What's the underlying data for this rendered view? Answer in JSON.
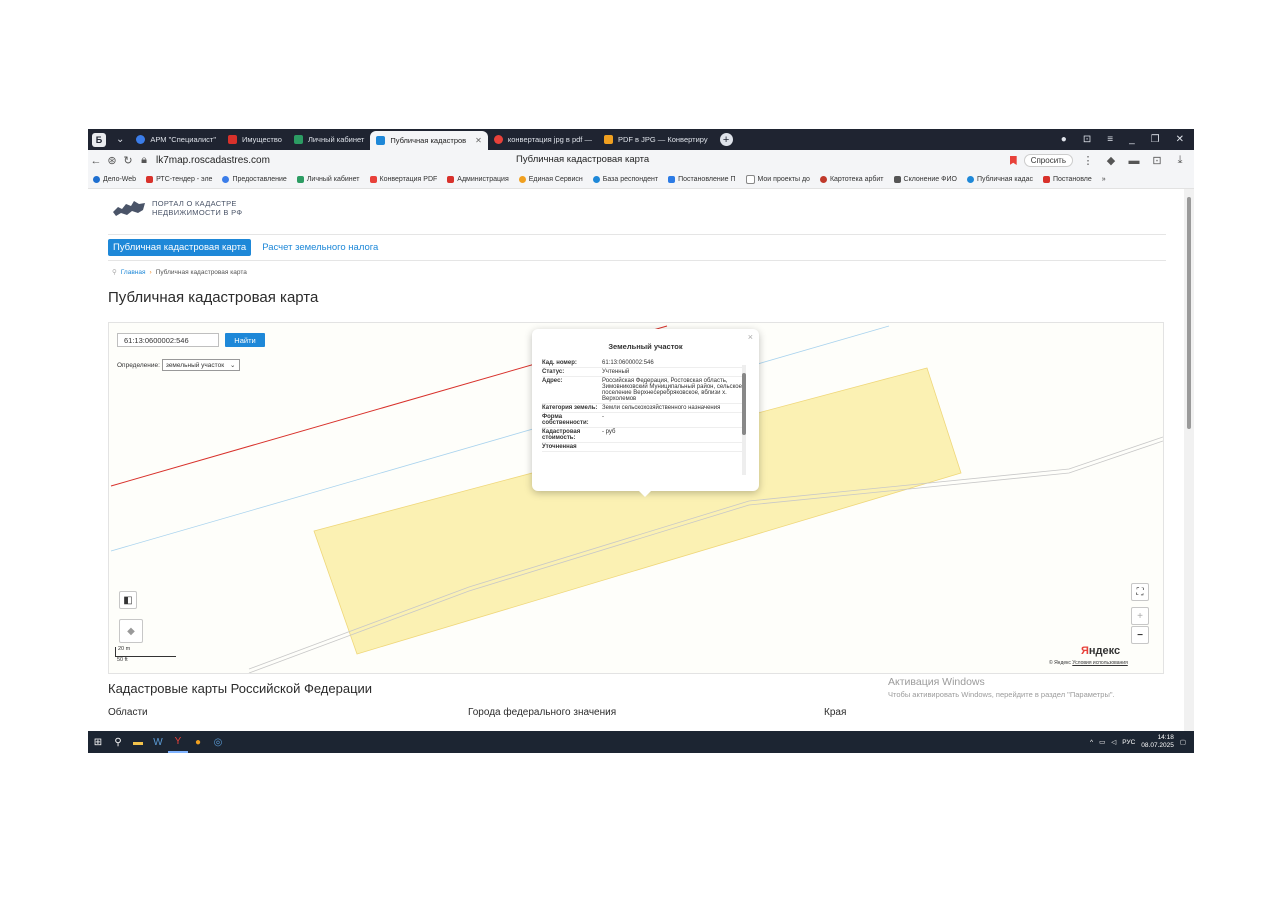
{
  "browser": {
    "tabs": [
      {
        "label": "АРМ \"Специалист\"",
        "color": "#3b7de9"
      },
      {
        "label": "Имущество",
        "color": "#d8312b"
      },
      {
        "label": "Личный кабинет",
        "color": "#2c9c63"
      },
      {
        "label": "Публичная кадастров",
        "color": "#1e88d8",
        "active": true
      },
      {
        "label": "конвертация jpg в pdf —",
        "color": "#e8413a"
      },
      {
        "label": "PDF в JPG — Конвертиру",
        "color": "#f0a020"
      }
    ],
    "url": "lk7map.roscadastres.com",
    "page_title": "Публичная кадастровая карта",
    "ask_label": "Спросить",
    "bookmarks": [
      {
        "label": "Дело-Web",
        "color": "#1e6fd0"
      },
      {
        "label": "РТС-тендер - эле",
        "color": "#d8312b"
      },
      {
        "label": "Предоставление",
        "color": "#3b7de9"
      },
      {
        "label": "Личный кабинет",
        "color": "#2c9c63"
      },
      {
        "label": "Конвертация PDF",
        "color": "#e8413a"
      },
      {
        "label": "Администрация",
        "color": "#d8312b"
      },
      {
        "label": "Единая Сервисн",
        "color": "#f0a020"
      },
      {
        "label": "База респондент",
        "color": "#1e88d8"
      },
      {
        "label": "Постановление П",
        "color": "#2c7be5"
      },
      {
        "label": "Мои проекты до",
        "color": "#888888"
      },
      {
        "label": "Картотека арбит",
        "color": "#c0392b"
      },
      {
        "label": "Склонение ФИО",
        "color": "#555555"
      },
      {
        "label": "Публичная кадас",
        "color": "#1e88d8"
      },
      {
        "label": "Постановле",
        "color": "#d8312b"
      }
    ]
  },
  "portal": {
    "logo_line1": "Портал о кадастре",
    "logo_line2": "недвижимости в РФ",
    "nav_active": "Публичная кадастровая карта",
    "nav_other": "Расчет земельного налога",
    "crumb_home": "Главная",
    "crumb_current": "Публичная кадастровая карта",
    "heading": "Публичная кадастровая карта"
  },
  "map": {
    "search_value": "61:13:0600002:546",
    "search_button": "Найти",
    "define_label": "Определение:",
    "define_value": "земельный участок",
    "scale_m": "20 m",
    "scale_ft": "50 ft",
    "yandex_Y": "Я",
    "yandex_rest": "ндекс",
    "copyright": "© Яндекс",
    "terms": "Условия использования",
    "parcel_color": "#fbf1b3",
    "red_line_color": "#d8312b"
  },
  "popup": {
    "title": "Земельный участок",
    "close": "×",
    "rows": [
      {
        "k": "Кад. номер:",
        "v": "61:13:0600002:546"
      },
      {
        "k": "Статус:",
        "v": "Учтенный"
      },
      {
        "k": "Адрес:",
        "v": "Российская Федерация, Ростовская область, Зимовниковский Муниципальный район, сельское поселение Верхнесеребряковское, вблизи х. Верхолемов"
      },
      {
        "k": "Категория земель:",
        "v": "Земли сельскохозяйственного назначения"
      },
      {
        "k": "Форма собственности:",
        "v": "-"
      },
      {
        "k": "Кадастровая стоимость:",
        "v": "- руб"
      },
      {
        "k": "Уточненная",
        "v": ""
      }
    ]
  },
  "below": {
    "section_title": "Кадастровые карты Российской Федерации",
    "col1": "Области",
    "col2": "Города федерального значения",
    "col3": "Края"
  },
  "windows": {
    "activate_title": "Активация Windows",
    "activate_text": "Чтобы активировать Windows, перейдите в раздел \"Параметры\".",
    "lang": "РУС",
    "time": "14:18",
    "date": "08.07.2025"
  }
}
